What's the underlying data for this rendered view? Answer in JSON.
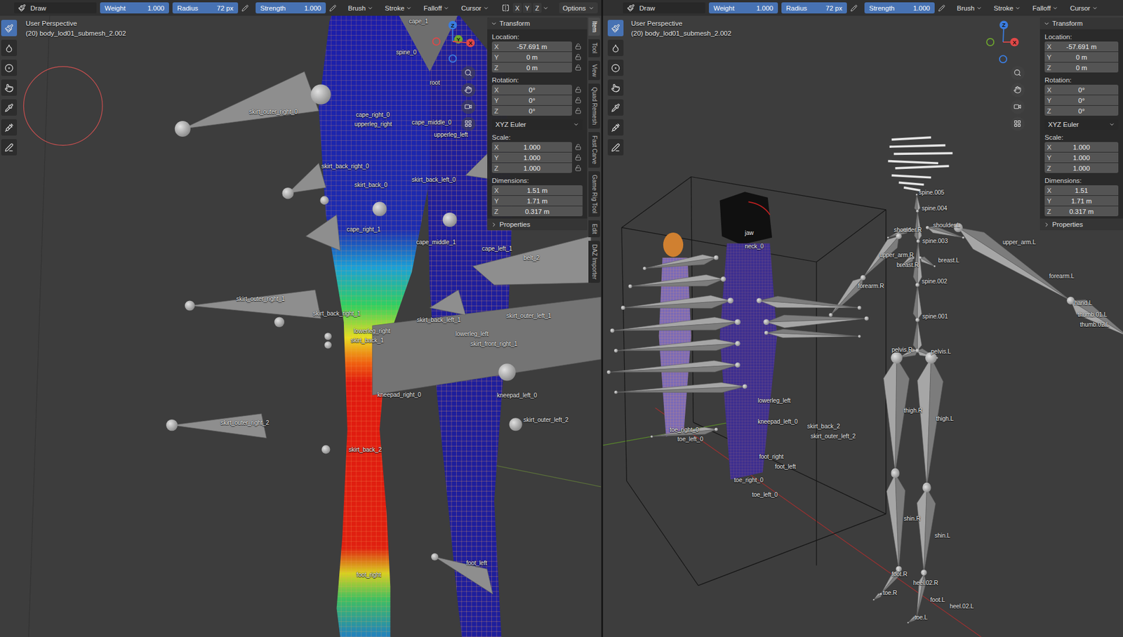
{
  "viewports": [
    {
      "header": {
        "mode": "Draw",
        "fields": [
          {
            "label": "Weight",
            "value": "1.000"
          },
          {
            "label": "Radius",
            "value": "72 px"
          },
          {
            "label": "Strength",
            "value": "1.000"
          }
        ],
        "menus": [
          "Brush",
          "Stroke",
          "Falloff",
          "Cursor"
        ],
        "symmetry": [
          "X",
          "Y",
          "Z"
        ],
        "options": "Options"
      },
      "view_name": "User Perspective",
      "object_name": "(20) body_lod01_submesh_2.002",
      "tools": [
        {
          "selected": true
        },
        {
          "selected": false
        },
        {
          "selected": false
        },
        {
          "selected": false
        },
        {
          "selected": false
        },
        {
          "selected": false
        },
        {
          "selected": false
        }
      ],
      "gizmo": [
        {
          "label": "Z",
          "color": "#3b7de0"
        },
        {
          "label": "Y",
          "color": "#6ea62e"
        },
        {
          "label": "X",
          "color": "#e04848"
        }
      ],
      "bone_labels": [
        "cape_1",
        "spine_0",
        "root",
        "skirt_outer_right_0",
        "cape_right_0",
        "upperleg_right",
        "cape_middle_0",
        "upperleg_left",
        "skirt_back_right_0",
        "skirt_back_left_0",
        "skirt_back_0",
        "cape_right_1",
        "cape_middle_1",
        "cape_left_1",
        "belt_2",
        "skirt_outer_right_1",
        "skirt_back_right_1",
        "skirt_outer_left_1",
        "skirt_back_left_1",
        "lowerleg_right",
        "lowerleg_left",
        "skirt_back_1",
        "skirt_front_right_1",
        "kneepad_right_0",
        "kneepad_left_0",
        "skirt_outer_left_2",
        "skirt_outer_right_2",
        "skirt_back_2",
        "foot_left",
        "foot_right"
      ],
      "sidebar_tabs": [
        {
          "label": "Item",
          "selected": true
        },
        {
          "label": "Tool",
          "selected": false
        },
        {
          "label": "View",
          "selected": false
        },
        {
          "label": "Quad Remesh",
          "selected": false
        },
        {
          "label": "Fast Carve",
          "selected": false
        },
        {
          "label": "Game Rig Tool",
          "selected": false
        },
        {
          "label": "Edit",
          "selected": false
        },
        {
          "label": "DAZ Importer",
          "selected": false
        }
      ],
      "transform": {
        "title": "Transform",
        "groups": [
          {
            "kind": "fields",
            "label": "Location:",
            "lockable": true,
            "rows": [
              {
                "axis": "X",
                "value": "-57.691 m"
              },
              {
                "axis": "Y",
                "value": "0 m"
              },
              {
                "axis": "Z",
                "value": "0 m"
              }
            ]
          },
          {
            "kind": "fields",
            "label": "Rotation:",
            "lockable": true,
            "rows": [
              {
                "axis": "X",
                "value": "0°"
              },
              {
                "axis": "Y",
                "value": "0°"
              },
              {
                "axis": "Z",
                "value": "0°"
              }
            ]
          },
          {
            "kind": "dropdown",
            "value": "XYZ Euler"
          },
          {
            "kind": "fields",
            "label": "Scale:",
            "lockable": true,
            "rows": [
              {
                "axis": "X",
                "value": "1.000"
              },
              {
                "axis": "Y",
                "value": "1.000"
              },
              {
                "axis": "Z",
                "value": "1.000"
              }
            ]
          },
          {
            "kind": "fields",
            "label": "Dimensions:",
            "lockable": false,
            "rows": [
              {
                "axis": "X",
                "value": "1.51 m"
              },
              {
                "axis": "Y",
                "value": "1.71 m"
              },
              {
                "axis": "Z",
                "value": "0.317 m"
              }
            ]
          }
        ],
        "properties": "Properties"
      }
    },
    {
      "header": {
        "mode": "Draw",
        "fields": [
          {
            "label": "Weight",
            "value": "1.000"
          },
          {
            "label": "Radius",
            "value": "72 px"
          },
          {
            "label": "Strength",
            "value": "1.000"
          }
        ],
        "menus": [
          "Brush",
          "Stroke",
          "Falloff",
          "Cursor"
        ]
      },
      "view_name": "User Perspective",
      "object_name": "(20) body_lod01_submesh_2.002",
      "tools": [
        {
          "selected": true
        },
        {
          "selected": false
        },
        {
          "selected": false
        },
        {
          "selected": false
        },
        {
          "selected": false
        },
        {
          "selected": false
        },
        {
          "selected": false
        }
      ],
      "gizmo": [
        {
          "label": "Z",
          "color": "#3b7de0"
        },
        {
          "label": "X",
          "color": "#e04848"
        }
      ],
      "bone_labels": [
        "jaw",
        "neck_0",
        "forearm.R",
        "spine.005",
        "spine.004",
        "shoulder.L",
        "shoulder.R",
        "spine.003",
        "upper_arm.L",
        "upper_arm.R",
        "breast.R",
        "breast.L",
        "forearm.L",
        "spine.002",
        "hand.L",
        "thumb.01.L",
        "thumb.02.L",
        "spine.001",
        "pelvis.R",
        "pelvis.L",
        "thigh.R",
        "thigh.L",
        "shin.R",
        "shin.L",
        "foot.R",
        "heel.02.R",
        "toe.R",
        "foot.L",
        "heel.02.L",
        "toe.L",
        "lowerleg_left",
        "kneepad_left_0",
        "skirt_back_2",
        "skirt_outer_left_2",
        "foot_right",
        "foot_left",
        "toe_right_0",
        "toe_left_0",
        "toe_right_0",
        "toe_left_0"
      ],
      "transform": {
        "title": "Transform",
        "groups": [
          {
            "kind": "fields",
            "label": "Location:",
            "lockable": false,
            "rows": [
              {
                "axis": "X",
                "value": "-57.691 m"
              },
              {
                "axis": "Y",
                "value": "0 m"
              },
              {
                "axis": "Z",
                "value": "0 m"
              }
            ]
          },
          {
            "kind": "fields",
            "label": "Rotation:",
            "lockable": false,
            "rows": [
              {
                "axis": "X",
                "value": "0°"
              },
              {
                "axis": "Y",
                "value": "0°"
              },
              {
                "axis": "Z",
                "value": "0°"
              }
            ]
          },
          {
            "kind": "dropdown",
            "value": "XYZ Euler"
          },
          {
            "kind": "fields",
            "label": "Scale:",
            "lockable": false,
            "rows": [
              {
                "axis": "X",
                "value": "1.000"
              },
              {
                "axis": "Y",
                "value": "1.000"
              },
              {
                "axis": "Z",
                "value": "1.000"
              }
            ]
          },
          {
            "kind": "fields",
            "label": "Dimensions:",
            "lockable": false,
            "rows": [
              {
                "axis": "X",
                "value": "1.51"
              },
              {
                "axis": "Y",
                "value": "1.71 m"
              },
              {
                "axis": "Z",
                "value": "0.317 m"
              }
            ]
          }
        ],
        "properties": "Properties"
      }
    }
  ]
}
